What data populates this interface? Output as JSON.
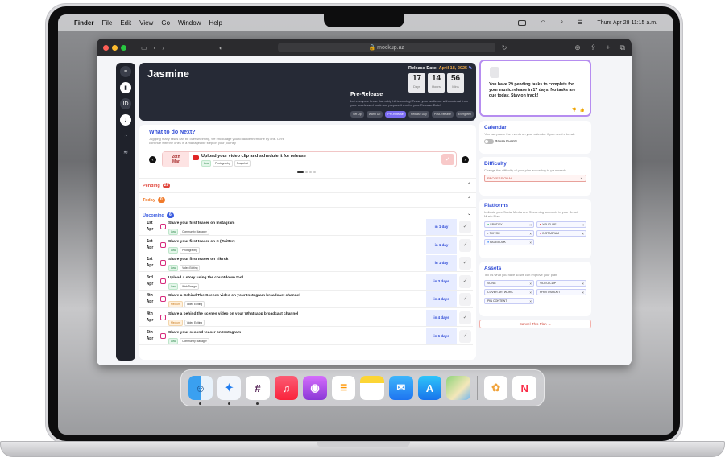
{
  "menubar": {
    "apple": "",
    "items": [
      "Finder",
      "File",
      "Edit",
      "View",
      "Go",
      "Window",
      "Help"
    ],
    "clock": "Thurs Apr 28 11:15 a.m."
  },
  "browser": {
    "url": "mockup.az"
  },
  "hero": {
    "artist": "Jasmine",
    "release_label": "Release Date:",
    "release_date": "April 18, 2025",
    "countdown": [
      {
        "value": "17",
        "unit": "Days"
      },
      {
        "value": "14",
        "unit": "Hours"
      },
      {
        "value": "56",
        "unit": "Mins"
      }
    ],
    "phase_title": "Pre-Release",
    "phase_desc": "Let everyone know that a big hit is coming! Tease your audience with material from your unreleased track and prepare them for your Release Date!",
    "stages": [
      "Set Up",
      "Warm Up",
      "Pre-Release",
      "Release Day",
      "Post-Release",
      "Evergreen"
    ]
  },
  "todo": {
    "title": "What to do Next?",
    "desc": "Juggling many tasks can be overwhelming, we encourage you to tackle them one by one. Let's continue with the ones in a manageable step on your journey",
    "carousel": {
      "date_day": "28th",
      "date_month": "Mar",
      "title": "Upload your video clip and schedule it for release",
      "tags": [
        "Low",
        "Photography",
        "Snapchat"
      ]
    },
    "sections": {
      "pending_label": "Pending",
      "pending_count": "29",
      "today_label": "Today",
      "today_count": "0",
      "upcoming_label": "Upcoming",
      "upcoming_count": "6"
    },
    "tasks": [
      {
        "day": "1st",
        "month": "Apr",
        "title": "Share your first teaser on Instagram",
        "priority": "Low",
        "tag": "Community Manager",
        "due": "in 1 day"
      },
      {
        "day": "1st",
        "month": "Apr",
        "title": "Share your first teaser on X (Twitter)",
        "priority": "Low",
        "tag": "Photography",
        "due": "in 1 day"
      },
      {
        "day": "1st",
        "month": "Apr",
        "title": "Share your first teaser on TikTok",
        "priority": "Low",
        "tag": "Video Editing",
        "due": "in 1 day"
      },
      {
        "day": "3rd",
        "month": "Apr",
        "title": "Upload a story using the countdown tool",
        "priority": "Low",
        "tag": "Web Design",
        "due": "in 3 days"
      },
      {
        "day": "4th",
        "month": "Apr",
        "title": "Share a Behind The Scenes video on your Instagram broadcast channel",
        "priority": "Medium",
        "tag": "Video Editing",
        "due": "in 4 days"
      },
      {
        "day": "4th",
        "month": "Apr",
        "title": "Share a behind the scenes video on your Whatsapp broadcast channel",
        "priority": "Medium",
        "tag": "Video Editing",
        "due": "in 4 days"
      },
      {
        "day": "6th",
        "month": "Apr",
        "title": "Share your second teaser on Instagram",
        "priority": "Low",
        "tag": "Community Manager",
        "due": "in 6 days"
      }
    ]
  },
  "assistant": {
    "message": "You have 29 pending tasks to complete for your music release in 17 days. No tasks are due today. Stay on track!"
  },
  "calendar": {
    "title": "Calendar",
    "desc": "You can pause the events on your calendar if you need a break.",
    "toggle_label": "Pause Events"
  },
  "difficulty": {
    "title": "Difficulty",
    "desc": "Change the difficulty of your plan according to your needs.",
    "value": "PROFESSIONAL"
  },
  "platforms": {
    "title": "Platforms",
    "desc": "Indicate your Social Media and Streaming accounts to your Smart Music Plan",
    "chips": [
      "SPOTIFY",
      "YOUTUBE",
      "TIKTOK",
      "INSTAGRAM",
      "FACEBOOK"
    ]
  },
  "assets": {
    "title": "Assets",
    "desc": "Tell us what you have so we can improve your plan!",
    "chips": [
      "SONG",
      "VIDEO CLIP",
      "COVER ARTWORK",
      "PHOTOSHOOT",
      "PIN CONTENT"
    ]
  },
  "cancel_label": "Cancel This Plan →",
  "colors": {
    "accent": "#2f4bd6",
    "purple": "#7b6cf2",
    "pending": "#e0443a",
    "today": "#f07a2a",
    "upcoming": "#3b5ce0"
  },
  "dock": [
    "finder-icon",
    "safari-icon",
    "slack-icon",
    "music-icon",
    "podcasts-icon",
    "reminders-icon",
    "notes-icon",
    "mail-icon",
    "app-store-icon",
    "maps-icon",
    "photos-icon",
    "news-icon"
  ]
}
